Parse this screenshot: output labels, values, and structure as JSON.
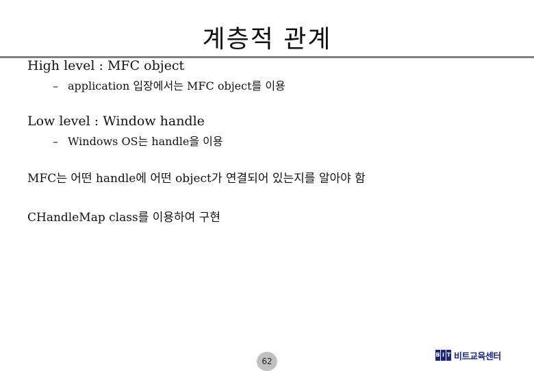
{
  "slide": {
    "title": "계층적 관계",
    "lines": [
      {
        "text": "High level : MFC object",
        "level": 1
      },
      {
        "text": "application 입장에서는 MFC object를 이용",
        "level": 2
      },
      {
        "text": "Low level : Window handle",
        "level": 1
      },
      {
        "text": "Windows OS는 handle을 이용",
        "level": 2
      },
      {
        "text": "MFC는 어떤 handle에 어떤 object가 연결되어 있는지를 알아야 함",
        "level": 1
      },
      {
        "text": "CHandleMap class를 이용하여 구현",
        "level": 1
      }
    ],
    "sub_bullet": "–"
  },
  "footer": {
    "page_number": "62",
    "logo": {
      "letters": [
        "B",
        "I",
        "T"
      ],
      "text": "비트교육센터",
      "color": "#1a237e"
    }
  }
}
